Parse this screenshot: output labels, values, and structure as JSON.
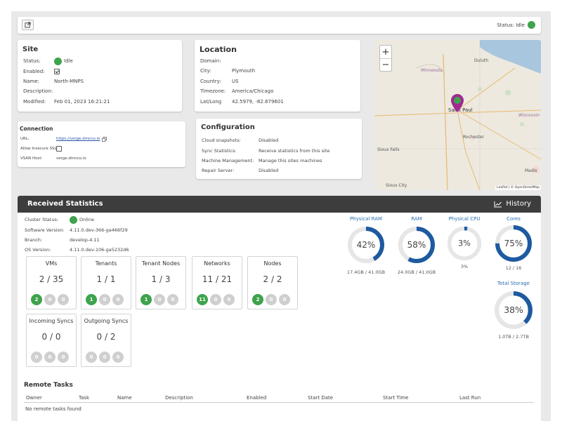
{
  "topbar": {
    "status_label": "Status: Idle",
    "status_color": "#3fa34d",
    "open_icon": "external-link-icon"
  },
  "site": {
    "title": "Site",
    "status_label": "Status:",
    "status_value": "Idle",
    "enabled_label": "Enabled:",
    "enabled_checked": true,
    "name_label": "Name:",
    "name_value": "North-MNPS",
    "description_label": "Description:",
    "description_value": "",
    "modified_label": "Modified:",
    "modified_value": "Feb 01, 2023 16:21:21"
  },
  "location": {
    "title": "Location",
    "domain_label": "Domain:",
    "domain_value": "",
    "city_label": "City:",
    "city_value": "Plymouth",
    "country_label": "Country:",
    "country_value": "US",
    "timezone_label": "Timezone:",
    "timezone_value": "America/Chicago",
    "latlong_label": "Lat/Long",
    "latlong_value": "42.5979, -82.879601"
  },
  "connection": {
    "title": "Connection",
    "url_label": "URL:",
    "url_value": "https://verge.dmnco.io",
    "copy_icon": "copy-icon",
    "insecure_label": "Allow Insecure SSL:",
    "insecure_checked": false,
    "vsan_label": "VSAN Host:",
    "vsan_value": "verge.dmnco.io"
  },
  "configuration": {
    "title": "Configuration",
    "rows": [
      {
        "label": "Cloud snapshots:",
        "value": "Disabled"
      },
      {
        "label": "Sync Statistics:",
        "value": "Receive statistics from this site"
      },
      {
        "label": "Machine Management:",
        "value": "Manage this sites machines"
      },
      {
        "label": "Repair Server:",
        "value": "Disabled"
      }
    ]
  },
  "map": {
    "zoom_in": "+",
    "zoom_out": "−",
    "labels": {
      "duluth": "Duluth",
      "minnesota": "Minnesota",
      "saint_paul": "Saint Paul",
      "wisconsin": "Wisconsin",
      "rochester": "Rochester",
      "sioux_falls": "Sioux Falls",
      "madison": "Madis",
      "sioux_city": "Sioux City"
    },
    "attribution": "Leaflet | © OpenStreetMap"
  },
  "stats": {
    "title": "Received Statistics",
    "history_label": "History",
    "cluster_status_label": "Cluster Status:",
    "cluster_status_value": "Online",
    "software_label": "Software Version:",
    "software_value": "4.11.0.dev-366-ga466f29",
    "branch_label": "Branch:",
    "branch_value": "develop-4.11",
    "os_label": "OS Version:",
    "os_value": "4.11.0.dev-106-ga5232d6",
    "tiles": [
      {
        "title": "VMs",
        "count": "2 / 35",
        "badges": [
          "2",
          "0",
          "0"
        ]
      },
      {
        "title": "Tenants",
        "count": "1 / 1",
        "badges": [
          "1",
          "0",
          "0"
        ]
      },
      {
        "title": "Tenant Nodes",
        "count": "1 / 3",
        "badges": [
          "1",
          "0",
          "0"
        ]
      },
      {
        "title": "Networks",
        "count": "11 / 21",
        "badges": [
          "11",
          "0",
          "0"
        ]
      },
      {
        "title": "Nodes",
        "count": "2 / 2",
        "badges": [
          "2",
          "0",
          "0"
        ]
      },
      {
        "title": "Incoming Syncs",
        "count": "0 / 0",
        "badges": [
          "0",
          "0",
          "0"
        ]
      },
      {
        "title": "Outgoing Syncs",
        "count": "0 / 2",
        "badges": [
          "0",
          "0",
          "0"
        ]
      }
    ],
    "gauges": [
      {
        "title": "Physical RAM",
        "label": "42%",
        "value": 0.42,
        "sub": "17.4GB / 41.0GB"
      },
      {
        "title": "RAM",
        "label": "58%",
        "value": 0.58,
        "sub": "24.0GB / 41.0GB"
      },
      {
        "title": "Physical CPU",
        "label": "3%",
        "value": 0.03,
        "sub": "3%"
      },
      {
        "title": "Cores",
        "label": "75%",
        "value": 0.75,
        "sub": "12 / 16"
      },
      {
        "title": "Total Storage",
        "label": "38%",
        "value": 0.38,
        "sub": "1.0TB / 2.7TB"
      }
    ],
    "gauge_color": "#1d5aa0",
    "gauge_track": "#e6e6e6"
  },
  "remote_tasks": {
    "title": "Remote Tasks",
    "columns": [
      "Owner",
      "Task",
      "Name",
      "Description",
      "Enabled",
      "Start Date",
      "Start Time",
      "Last Run"
    ],
    "empty_text": "No remote tasks found"
  }
}
